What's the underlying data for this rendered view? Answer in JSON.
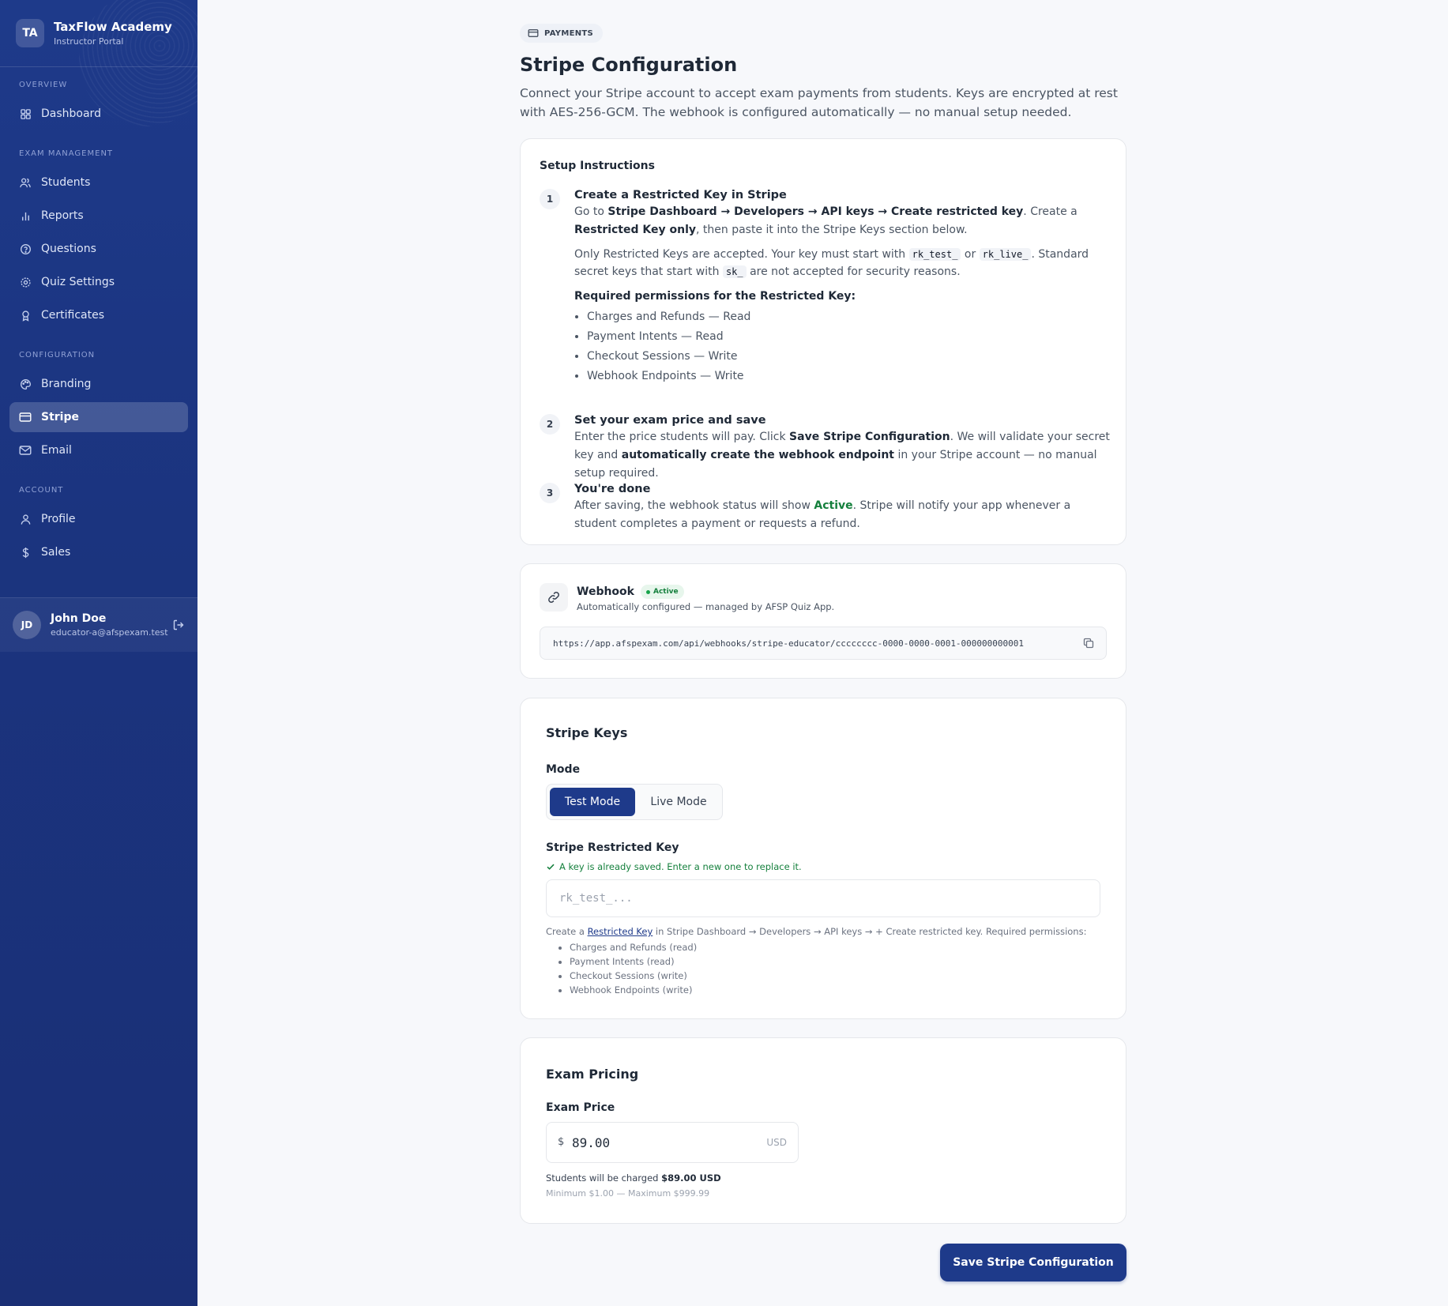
{
  "brand": {
    "initials": "TA",
    "title": "TaxFlow Academy",
    "subtitle": "Instructor Portal"
  },
  "nav": {
    "overview_label": "OVERVIEW",
    "dashboard": "Dashboard",
    "exam_label": "EXAM MANAGEMENT",
    "students": "Students",
    "reports": "Reports",
    "questions": "Questions",
    "quiz_settings": "Quiz Settings",
    "certificates": "Certificates",
    "config_label": "CONFIGURATION",
    "branding": "Branding",
    "stripe": "Stripe",
    "email": "Email",
    "account_label": "ACCOUNT",
    "profile": "Profile",
    "sales": "Sales",
    "active_item": "Stripe"
  },
  "user": {
    "initials": "JD",
    "name": "John Doe",
    "email": "educator-a@afspexam.test"
  },
  "page": {
    "pill": "PAYMENTS",
    "title": "Stripe Configuration",
    "description": "Connect your Stripe account to accept exam payments from students. Keys are encrypted at rest with AES-256-GCM. The webhook is configured automatically — no manual setup needed."
  },
  "setup": {
    "title": "Setup Instructions",
    "step1": {
      "num": "1",
      "title": "Create a Restricted Key in Stripe",
      "t1": "Go to ",
      "b1": "Stripe Dashboard → Developers → API keys → Create restricted key",
      "t2": ". Create a ",
      "b2": "Restricted Key only",
      "t3": ", then paste it into the Stripe Keys section below.",
      "p2_a": "Only Restricted Keys are accepted. Your key must start with ",
      "code1": "rk_test_",
      "p2_or": " or ",
      "code2": "rk_live_",
      "p2_b": ". Standard secret keys that start with ",
      "code3": "sk_",
      "p2_c": " are not accepted for security reasons.",
      "perm_title": "Required permissions for the Restricted Key:",
      "perms": [
        "Charges and Refunds — Read",
        "Payment Intents — Read",
        "Checkout Sessions — Write",
        "Webhook Endpoints — Write"
      ]
    },
    "step2": {
      "num": "2",
      "title": "Set your exam price and save",
      "t1": "Enter the price students will pay. Click ",
      "b1": "Save Stripe Configuration",
      "t2": ". We will validate your secret key and ",
      "b2": "automatically create the webhook endpoint",
      "t3": " in your Stripe account — no manual setup required."
    },
    "step3": {
      "num": "3",
      "title": "You're done",
      "t1": "After saving, the webhook status will show ",
      "g1": "Active",
      "t2": ". Stripe will notify your app whenever a student completes a payment or requests a refund."
    }
  },
  "webhook": {
    "title": "Webhook",
    "status": "Active",
    "subtitle": "Automatically configured — managed by AFSP Quiz App.",
    "url": "https://app.afspexam.com/api/webhooks/stripe-educator/cccccccc-0000-0000-0001-000000000001"
  },
  "keys": {
    "title": "Stripe Keys",
    "mode_label": "Mode",
    "test_mode": "Test Mode",
    "live_mode": "Live Mode",
    "selected_mode": "Test Mode",
    "key_label": "Stripe Restricted Key",
    "saved_note": "A key is already saved. Enter a new one to replace it.",
    "key_placeholder": "rk_test_...",
    "help_a": "Create a ",
    "help_link": "Restricted Key",
    "help_b": " in Stripe Dashboard → Developers → API keys → + Create restricted key. Required permissions:",
    "perms": [
      "Charges and Refunds (read)",
      "Payment Intents (read)",
      "Checkout Sessions (write)",
      "Webhook Endpoints (write)"
    ]
  },
  "pricing": {
    "title": "Exam Pricing",
    "price_label": "Exam Price",
    "currency_symbol": "$",
    "price_value": "89.00",
    "unit": "USD",
    "charged_a": "Students will be charged ",
    "charged_b": "$89.00 USD",
    "minmax": "Minimum $1.00 — Maximum $999.99"
  },
  "save_button": "Save Stripe Configuration",
  "colors": {
    "primary": "#1e3a8a",
    "success": "#15803d",
    "sidebar": "#1e3a8a"
  }
}
